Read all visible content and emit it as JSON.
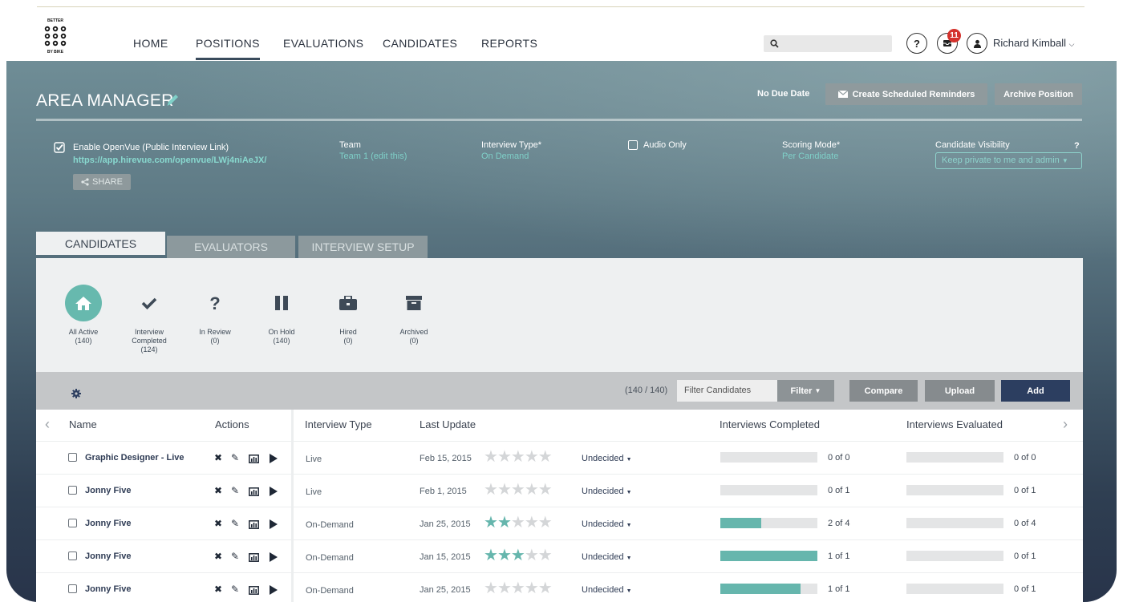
{
  "nav": {
    "logo_text": "BETTER BY BIKE",
    "items": [
      "HOME",
      "POSITIONS",
      "EVALUATIONS",
      "CANDIDATES",
      "REPORTS"
    ],
    "active": "POSITIONS",
    "search_placeholder": "",
    "help_label": "?",
    "notification_count": "11",
    "user_name": "Richard Kimball"
  },
  "position": {
    "title": "AREA MANAGER",
    "due_date": "No Due Date",
    "reminders_label": "Create Scheduled Reminders",
    "archive_label": "Archive Position"
  },
  "settings": {
    "openvue_label": "Enable OpenVue (Public Interview Link)",
    "openvue_link": "https://app.hirevue.com/openvue/LWj4niAeJX/",
    "share_label": "SHARE",
    "team_label": "Team",
    "team_value": "Team 1 (edit this)",
    "interview_type_label": "Interview Type*",
    "interview_type_value": "On Demand",
    "audio_only_label": "Audio Only",
    "scoring_mode_label": "Scoring Mode*",
    "scoring_mode_value": "Per Candidate",
    "visibility_label": "Candidate Visibility",
    "visibility_help": "?",
    "visibility_value": "Keep private to me and admin"
  },
  "tabs": [
    "CANDIDATES",
    "EVALUATORS",
    "INTERVIEW SETUP"
  ],
  "status_filters": [
    {
      "label": "All Active",
      "count": "(140)",
      "icon": "home-icon"
    },
    {
      "label": "Interview Completed",
      "count": "(124)",
      "icon": "check-icon"
    },
    {
      "label": "In Review",
      "count": "(0)",
      "icon": "question-icon"
    },
    {
      "label": "On Hold",
      "count": "(140)",
      "icon": "pause-icon"
    },
    {
      "label": "Hired",
      "count": "(0)",
      "icon": "briefcase-icon"
    },
    {
      "label": "Archived",
      "count": "(0)",
      "icon": "archive-box-icon"
    }
  ],
  "toolbar": {
    "count": "(140 / 140)",
    "filter_placeholder": "Filter Candidates",
    "filter_label": "Filter",
    "compare_label": "Compare",
    "upload_label": "Upload",
    "add_label": "Add",
    "colors": {
      "filter": "#8d9396",
      "compare": "#868b8e",
      "upload": "#868b8e",
      "add": "#2c3e60"
    }
  },
  "table": {
    "headers": [
      "Name",
      "Actions",
      "Interview Type",
      "Last Update",
      "Interviews Completed",
      "Interviews Evaluated"
    ],
    "rows": [
      {
        "name": "Graphic Designer - Live",
        "type": "Live",
        "date": "Feb 15, 2015",
        "stars": 0,
        "decision": "Undecided",
        "completed": "0 of 0",
        "completed_fill": 0,
        "evaluated": "0 of 0",
        "evaluated_fill": 0
      },
      {
        "name": "Jonny Five",
        "type": "Live",
        "date": "Feb 1, 2015",
        "stars": 0,
        "decision": "Undecided",
        "completed": "0 of 1",
        "completed_fill": 0,
        "evaluated": "0 of 1",
        "evaluated_fill": 0
      },
      {
        "name": "Jonny Five",
        "type": "On-Demand",
        "date": "Jan 25, 2015",
        "stars": 2,
        "decision": "Undecided",
        "completed": "2 of 4",
        "completed_fill": 0.42,
        "evaluated": "0 of 4",
        "evaluated_fill": 0
      },
      {
        "name": "Jonny Five",
        "type": "On-Demand",
        "date": "Jan 15, 2015",
        "stars": 3,
        "decision": "Undecided",
        "completed": "1 of 1",
        "completed_fill": 1,
        "evaluated": "0 of 1",
        "evaluated_fill": 0
      },
      {
        "name": "Jonny Five",
        "type": "On-Demand",
        "date": "Jan 25, 2015",
        "stars": 0,
        "decision": "Undecided",
        "completed": "1 of 1",
        "completed_fill": 0.83,
        "evaluated": "0 of 1",
        "evaluated_fill": 0
      }
    ]
  },
  "colors": {
    "accent": "#66b6ad",
    "brand_dark": "#2c3e60",
    "badge": "#d4322c"
  }
}
